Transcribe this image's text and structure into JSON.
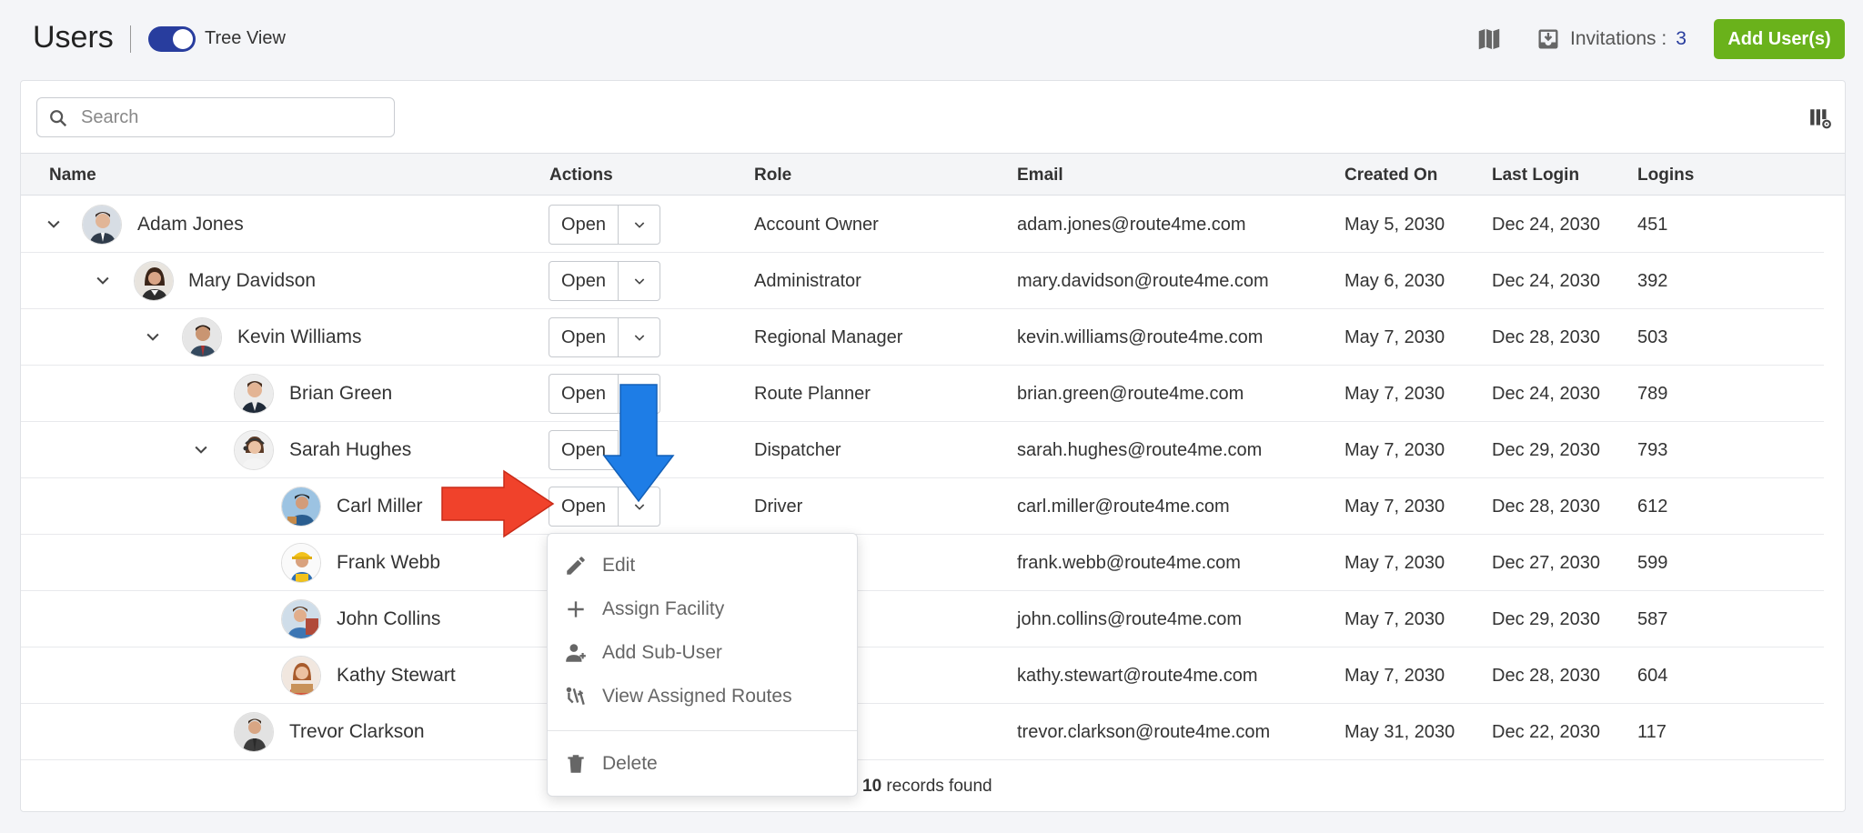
{
  "header": {
    "title": "Users",
    "tree_view_label": "Tree View",
    "invitations_label": "Invitations :",
    "invitations_count": "3",
    "add_button": "Add User(s)"
  },
  "search": {
    "placeholder": "Search",
    "value": ""
  },
  "table": {
    "columns": [
      "Name",
      "Actions",
      "Role",
      "Email",
      "Created On",
      "Last Login",
      "Logins"
    ],
    "rows": [
      {
        "name": "Adam Jones",
        "action": "Open",
        "role": "Account Owner",
        "email": "adam.jones@route4me.com",
        "created": "May 5, 2030",
        "last_login": "Dec 24, 2030",
        "logins": "451"
      },
      {
        "name": "Mary Davidson",
        "action": "Open",
        "role": "Administrator",
        "email": "mary.davidson@route4me.com",
        "created": "May 6, 2030",
        "last_login": "Dec 24, 2030",
        "logins": "392"
      },
      {
        "name": "Kevin Williams",
        "action": "Open",
        "role": "Regional Manager",
        "email": "kevin.williams@route4me.com",
        "created": "May 7, 2030",
        "last_login": "Dec 28, 2030",
        "logins": "503"
      },
      {
        "name": "Brian Green",
        "action": "Open",
        "role": "Route Planner",
        "email": "brian.green@route4me.com",
        "created": "May 7, 2030",
        "last_login": "Dec 24, 2030",
        "logins": "789"
      },
      {
        "name": "Sarah Hughes",
        "action": "Open",
        "role": "Dispatcher",
        "email": "sarah.hughes@route4me.com",
        "created": "May 7, 2030",
        "last_login": "Dec 29, 2030",
        "logins": "793"
      },
      {
        "name": "Carl Miller",
        "action": "Open",
        "role": "Driver",
        "email": "carl.miller@route4me.com",
        "created": "May 7, 2030",
        "last_login": "Dec 28, 2030",
        "logins": "612"
      },
      {
        "name": "Frank Webb",
        "action": "",
        "role": "",
        "email": "frank.webb@route4me.com",
        "created": "May 7, 2030",
        "last_login": "Dec 27, 2030",
        "logins": "599"
      },
      {
        "name": "John Collins",
        "action": "",
        "role": "",
        "email": "john.collins@route4me.com",
        "created": "May 7, 2030",
        "last_login": "Dec 29, 2030",
        "logins": "587"
      },
      {
        "name": "Kathy Stewart",
        "action": "",
        "role": "",
        "email": "kathy.stewart@route4me.com",
        "created": "May 7, 2030",
        "last_login": "Dec 28, 2030",
        "logins": "604"
      },
      {
        "name": "Trevor Clarkson",
        "action": "",
        "role": "",
        "email": "trevor.clarkson@route4me.com",
        "created": "May 31, 2030",
        "last_login": "Dec 22, 2030",
        "logins": "117"
      }
    ]
  },
  "footer": {
    "count": "10",
    "count_suffix": "records found"
  },
  "dropdown": {
    "items": [
      "Edit",
      "Assign Facility",
      "Add Sub-User",
      "View Assigned Routes",
      "Delete"
    ]
  },
  "colors": {
    "accent": "#283d9e",
    "add_button": "#6ab21b",
    "arrow_red": "#f0422b",
    "arrow_blue": "#1e7de6"
  }
}
